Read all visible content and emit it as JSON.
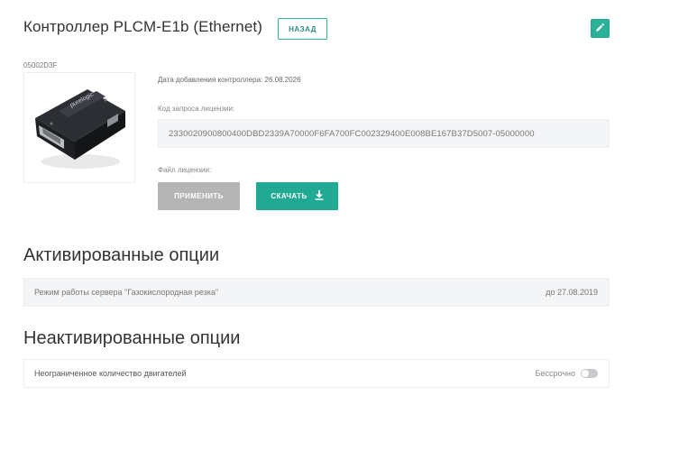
{
  "header": {
    "title": "Контроллер PLCM-E1b (Ethernet)",
    "back_label": "НАЗАД"
  },
  "device": {
    "serial": "05002D3F",
    "image_icon": "ethernet-controller-device",
    "added_date_text": "Дата добавления контроллера: 26.08.2026",
    "license_request_label": "Код запроса лицензии:",
    "license_request_code": "2330020900800400DBD2339A70000F6FA700FC002329400E008BE167B37D5007-05000000",
    "license_file_label": "Файл лицензии:",
    "apply_label": "ПРИМЕНИТЬ",
    "download_label": "СКАЧАТЬ"
  },
  "activated": {
    "title": "Активированные опции",
    "options": [
      {
        "name": "Режим работы сервера \"Газокислородная резка\"",
        "expires": "до 27.08.2019"
      }
    ]
  },
  "inactivated": {
    "title": "Неактивированные опции",
    "options": [
      {
        "name": "Неограниченное количество двигателей",
        "term": "Бессрочно",
        "enabled": false
      }
    ]
  },
  "colors": {
    "accent": "#22a993",
    "disabled_button": "#b5b5b5",
    "field_background": "#f4f5f7"
  }
}
